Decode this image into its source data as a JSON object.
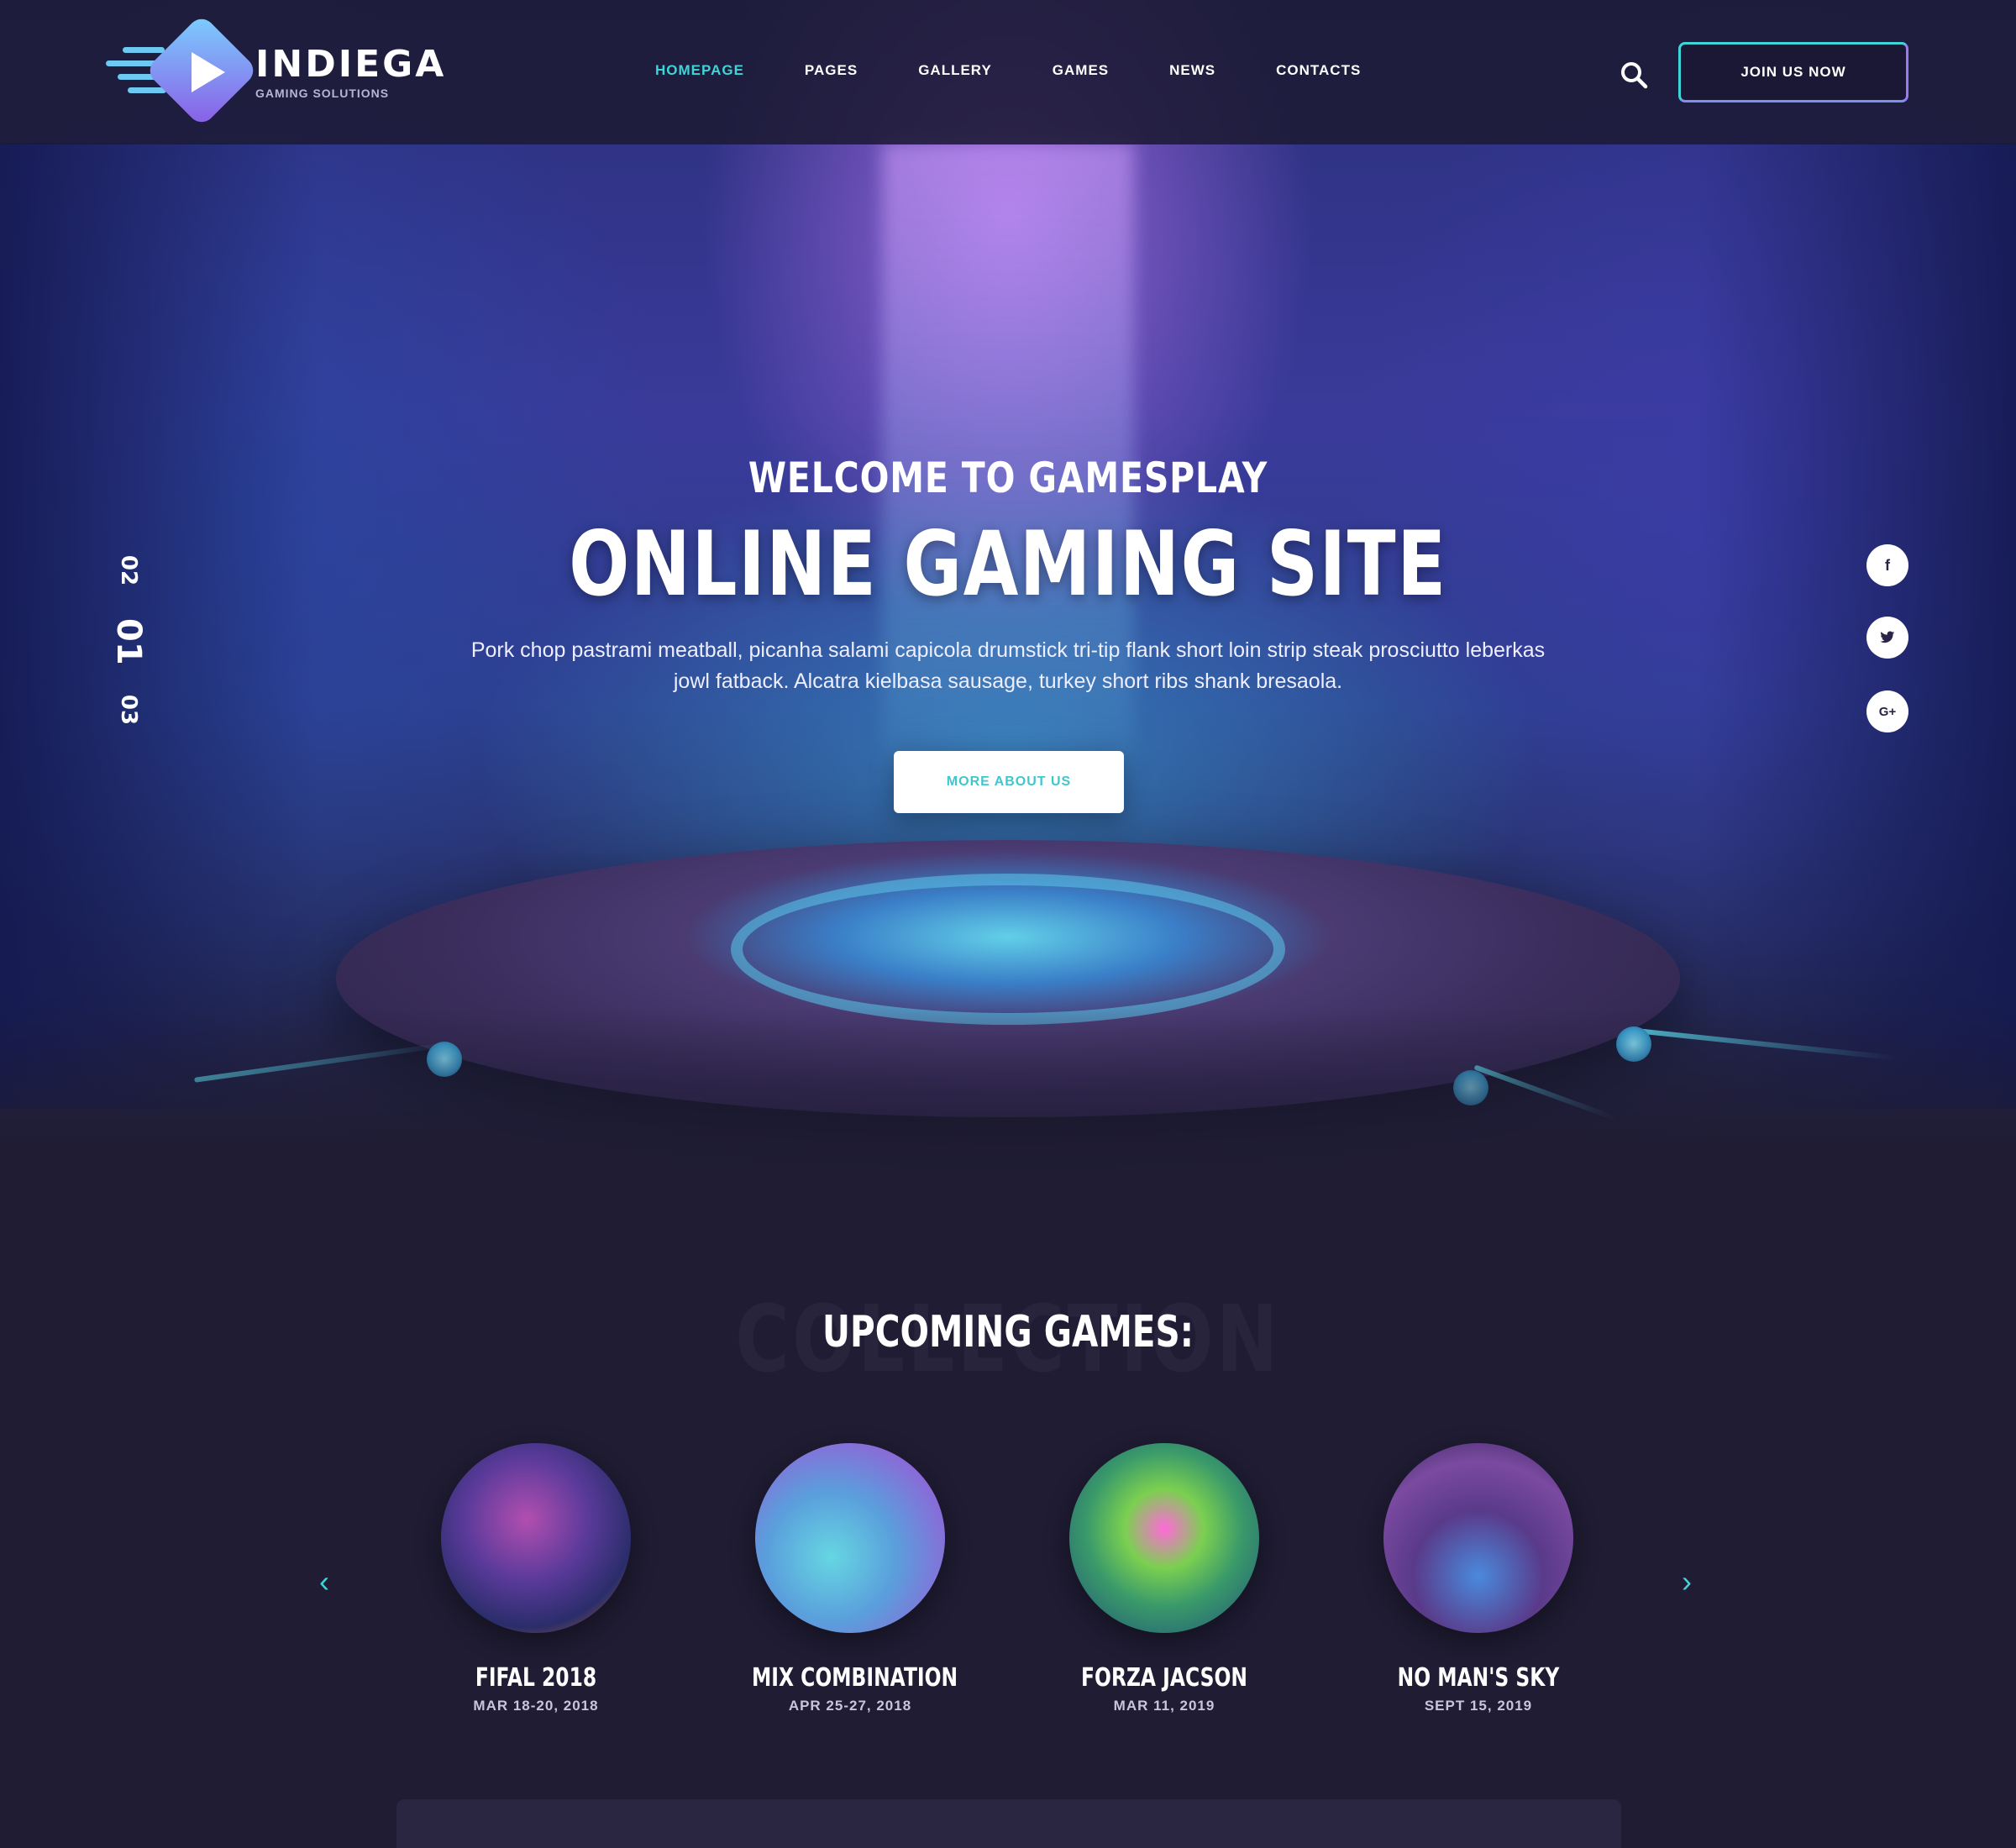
{
  "brand": {
    "name": "INDIEGA",
    "tagline": "GAMING SOLUTIONS"
  },
  "nav": {
    "items": [
      {
        "label": "HOMEPAGE",
        "active": true
      },
      {
        "label": "PAGES",
        "active": false
      },
      {
        "label": "GALLERY",
        "active": false
      },
      {
        "label": "GAMES",
        "active": false
      },
      {
        "label": "NEWS",
        "active": false
      },
      {
        "label": "CONTACTS",
        "active": false
      }
    ],
    "join_label": "JOIN US NOW"
  },
  "hero": {
    "kicker": "WELCOME TO GAMESPLAY",
    "title": "ONLINE GAMING SITE",
    "description": "Pork chop pastrami meatball, picanha salami capicola drumstick tri-tip flank short loin strip steak prosciutto leberkas jowl fatback. Alcatra kielbasa sausage, turkey short ribs shank bresaola.",
    "button_label": "MORE ABOUT US",
    "slides": [
      "02",
      "01",
      "03"
    ],
    "active_slide": "01"
  },
  "social": [
    {
      "name": "facebook",
      "glyph": "f"
    },
    {
      "name": "twitter",
      "glyph": "t"
    },
    {
      "name": "google-plus",
      "glyph": "G+"
    }
  ],
  "upcoming": {
    "title": "UPCOMING GAMES:",
    "ghost_text": "COLLECTION",
    "games": [
      {
        "title": "FIFAL 2018",
        "date": "MAR 18-20, 2018"
      },
      {
        "title": "MIX COMBINATION",
        "date": "APR 25-27, 2018"
      },
      {
        "title": "FORZA JACSON",
        "date": "MAR 11, 2019"
      },
      {
        "title": "NO MAN'S SKY",
        "date": "SEPT 15, 2019"
      }
    ]
  },
  "colors": {
    "accent": "#3fd4d8",
    "purple": "#8a5be6",
    "background": "#1f1c33"
  }
}
